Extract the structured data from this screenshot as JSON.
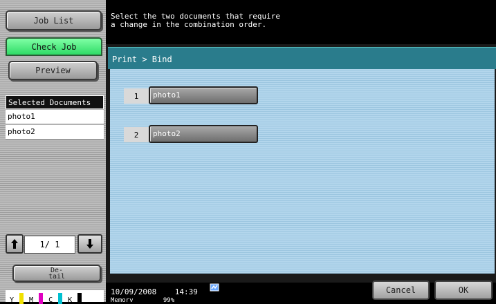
{
  "sidebar": {
    "job_list": "Job List",
    "check_job": "Check Job",
    "preview": "Preview",
    "selected_header": "Selected Documents",
    "selected_items": [
      "photo1",
      "photo2"
    ],
    "pager": "1/  1",
    "detail": "De-\ntail"
  },
  "message": "Select the two documents that require\na change in the combination order.",
  "breadcrumb": "Print > Bind",
  "documents": [
    {
      "num": "1",
      "name": "photo1"
    },
    {
      "num": "2",
      "name": "photo2"
    }
  ],
  "footer": {
    "datetime": "10/09/2008    14:39",
    "memory": "Memory        99%",
    "cancel": "Cancel",
    "ok": "OK"
  },
  "toner": {
    "labels": [
      "Y",
      "M",
      "C",
      "K"
    ],
    "colors": [
      "#f0e000",
      "#e000c0",
      "#00c0d0",
      "#000000"
    ]
  }
}
